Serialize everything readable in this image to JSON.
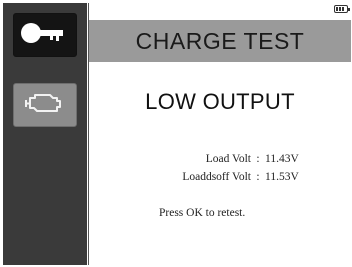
{
  "sidebar": {
    "items": [
      {
        "icon": "key-icon",
        "selected": true
      },
      {
        "icon": "engine-icon",
        "selected": false
      }
    ]
  },
  "status": {
    "icon": "battery-icon"
  },
  "header": {
    "title": "CHARGE TEST"
  },
  "result": {
    "text": "LOW OUTPUT"
  },
  "readings": [
    {
      "label": "Load Volt",
      "separator": ":",
      "value": "11.43V"
    },
    {
      "label": "Loaddsoff Volt",
      "separator": ":",
      "value": "11.53V"
    }
  ],
  "prompt": "Press OK to retest.",
  "colors": {
    "sidebar_bg": "#3a3a3a",
    "selected_button_bg": "#141414",
    "unselected_button_bg": "#8c8c8c",
    "titlebar_bg": "#9a9a9a",
    "content_bg": "#ffffff"
  }
}
